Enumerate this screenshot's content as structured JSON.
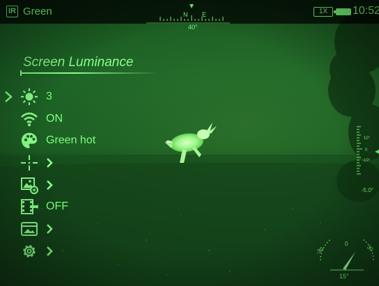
{
  "status_bar": {
    "mode_badge": "IR",
    "palette": "Green",
    "compass": {
      "north_label": "N",
      "east_label": "E",
      "heading": "40°"
    },
    "zoom": "1X",
    "battery_level": 1.0,
    "time": "10:52"
  },
  "menu": {
    "title": "Screen Luminance",
    "items": [
      {
        "icon": "brightness-icon",
        "value": "3",
        "selected": true
      },
      {
        "icon": "wifi-icon",
        "value": "ON"
      },
      {
        "icon": "palette-icon",
        "value": "Green hot"
      },
      {
        "icon": "crosshair-icon",
        "value": ""
      },
      {
        "icon": "image-settings-icon",
        "value": ""
      },
      {
        "icon": "video-record-icon",
        "value": "OFF"
      },
      {
        "icon": "gallery-icon",
        "value": ""
      },
      {
        "icon": "gear-icon",
        "value": ""
      }
    ]
  },
  "right_scale": {
    "labels": [
      "10°",
      "0",
      "-10°"
    ],
    "value": "-5.0°"
  },
  "inclinometer": {
    "left_label": "-30",
    "center_label": "0",
    "right_label": "30",
    "value": "15°"
  },
  "colors": {
    "overlay": "#7dff7d",
    "background": "#1b5e23"
  }
}
